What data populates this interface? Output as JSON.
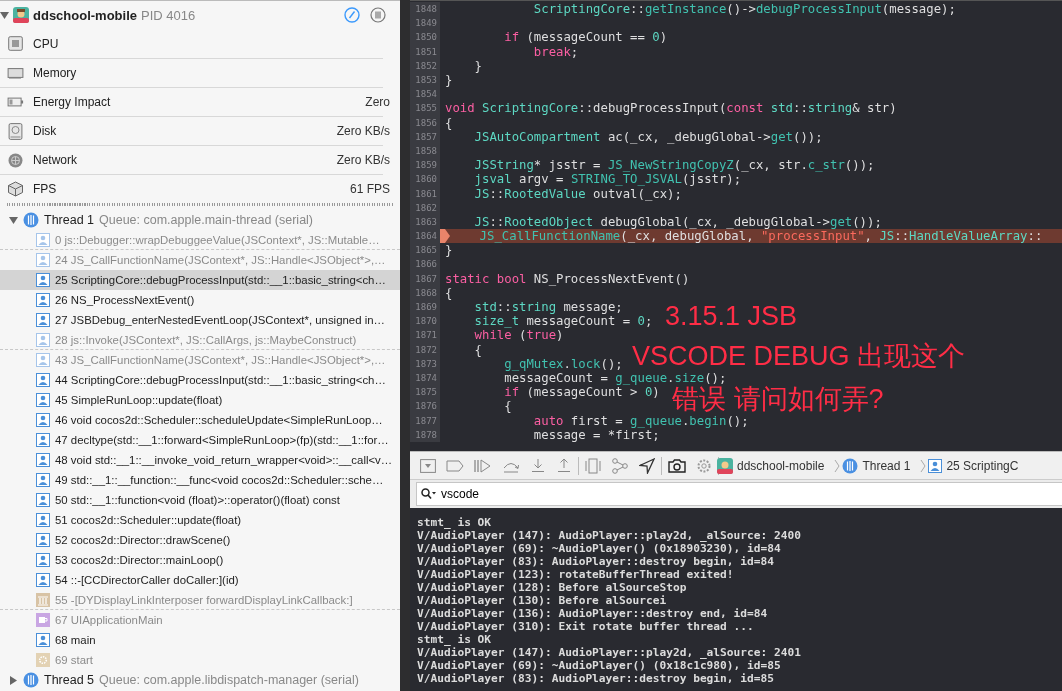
{
  "process": {
    "name": "ddschool-mobile",
    "pid": "PID 4016",
    "expanded": true
  },
  "gauges": [
    {
      "kind": "cpu",
      "label": "CPU"
    },
    {
      "kind": "memory",
      "label": "Memory"
    },
    {
      "kind": "energy",
      "label": "Energy Impact",
      "value": "Zero"
    },
    {
      "kind": "disk",
      "label": "Disk",
      "value": "Zero KB/s"
    },
    {
      "kind": "network",
      "label": "Network",
      "value": "Zero KB/s"
    },
    {
      "kind": "fps",
      "label": "FPS",
      "value": "61 FPS"
    }
  ],
  "threads": [
    {
      "name": "Thread 1",
      "queue": "Queue: com.apple.main-thread (serial)",
      "expanded": true,
      "frames": [
        {
          "kind": "system",
          "label": "0 js::Debugger::wrapDebuggeeValue(JSContext*, JS::Mutable…",
          "dimmed": true,
          "selected": false,
          "separator_after": true
        },
        {
          "kind": "system",
          "label": "24 JS_CallFunctionName(JSContext*, JS::Handle<JSObject*>,…",
          "dimmed": true,
          "selected": false,
          "separator_after": false
        },
        {
          "kind": "user",
          "label": "25 ScriptingCore::debugProcessInput(std::__1::basic_string<ch…",
          "dimmed": false,
          "selected": true,
          "separator_after": false
        },
        {
          "kind": "user",
          "label": "26 NS_ProcessNextEvent()",
          "dimmed": false,
          "selected": false,
          "separator_after": false
        },
        {
          "kind": "user",
          "label": "27 JSBDebug_enterNestedEventLoop(JSContext*, unsigned in…",
          "dimmed": false,
          "selected": false,
          "separator_after": false
        },
        {
          "kind": "system",
          "label": "28 js::Invoke(JSContext*, JS::CallArgs, js::MaybeConstruct)",
          "dimmed": true,
          "selected": false,
          "separator_after": true
        },
        {
          "kind": "system",
          "label": "43 JS_CallFunctionName(JSContext*, JS::Handle<JSObject*>,…",
          "dimmed": true,
          "selected": false,
          "separator_after": false
        },
        {
          "kind": "user",
          "label": "44 ScriptingCore::debugProcessInput(std::__1::basic_string<ch…",
          "dimmed": false,
          "selected": false,
          "separator_after": false
        },
        {
          "kind": "user",
          "label": "45 SimpleRunLoop::update(float)",
          "dimmed": false,
          "selected": false,
          "separator_after": false
        },
        {
          "kind": "user",
          "label": "46 void cocos2d::Scheduler::scheduleUpdate<SimpleRunLoop…",
          "dimmed": false,
          "selected": false,
          "separator_after": false
        },
        {
          "kind": "user",
          "label": "47 decltype(std::__1::forward<SimpleRunLoop>(fp)(std::__1::for…",
          "dimmed": false,
          "selected": false,
          "separator_after": false
        },
        {
          "kind": "user",
          "label": "48 void std::__1::__invoke_void_return_wrapper<void>::__call<v…",
          "dimmed": false,
          "selected": false,
          "separator_after": false
        },
        {
          "kind": "user",
          "label": "49 std::__1::__function::__func<void cocos2d::Scheduler::sche…",
          "dimmed": false,
          "selected": false,
          "separator_after": false
        },
        {
          "kind": "user",
          "label": "50 std::__1::function<void (float)>::operator()(float) const",
          "dimmed": false,
          "selected": false,
          "separator_after": false
        },
        {
          "kind": "user",
          "label": "51 cocos2d::Scheduler::update(float)",
          "dimmed": false,
          "selected": false,
          "separator_after": false
        },
        {
          "kind": "user",
          "label": "52 cocos2d::Director::drawScene()",
          "dimmed": false,
          "selected": false,
          "separator_after": false
        },
        {
          "kind": "user",
          "label": "53 cocos2d::Director::mainLoop()",
          "dimmed": false,
          "selected": false,
          "separator_after": false
        },
        {
          "kind": "user",
          "label": "54 ::-[CCDirectorCaller doCaller:](id)",
          "dimmed": false,
          "selected": false,
          "separator_after": false
        },
        {
          "kind": "library",
          "label": "55 -[DYDisplayLinkInterposer forwardDisplayLinkCallback:]",
          "dimmed": true,
          "selected": false,
          "separator_after": true
        },
        {
          "kind": "uikit",
          "label": "67 UIApplicationMain",
          "dimmed": true,
          "selected": false,
          "separator_after": false
        },
        {
          "kind": "user",
          "label": "68 main",
          "dimmed": false,
          "selected": false,
          "separator_after": false
        },
        {
          "kind": "start",
          "label": "69 start",
          "dimmed": true,
          "selected": false,
          "separator_after": false
        }
      ]
    },
    {
      "name": "Thread 5",
      "queue": "Queue: com.apple.libdispatch-manager (serial)",
      "expanded": false
    }
  ],
  "editor": {
    "lines": [
      {
        "number": "1848",
        "current": false,
        "tokens": [
          {
            "kind": "type",
            "text": "            ScriptingCore"
          },
          {
            "kind": "plain",
            "text": "::"
          },
          {
            "kind": "func",
            "text": "getInstance"
          },
          {
            "kind": "plain",
            "text": "()->"
          },
          {
            "kind": "func",
            "text": "debugProcessInput"
          },
          {
            "kind": "plain",
            "text": "(message);"
          }
        ]
      },
      {
        "number": "1849",
        "current": false
      },
      {
        "number": "1850",
        "current": false,
        "tokens": [
          {
            "kind": "keyword",
            "text": "        if"
          },
          {
            "kind": "plain",
            "text": " (messageCount == "
          },
          {
            "kind": "number",
            "text": "0"
          },
          {
            "kind": "plain",
            "text": ")"
          }
        ]
      },
      {
        "number": "1851",
        "current": false,
        "tokens": [
          {
            "kind": "keyword",
            "text": "            break"
          },
          {
            "kind": "plain",
            "text": ";"
          }
        ]
      },
      {
        "number": "1852",
        "current": false,
        "tokens": [
          {
            "kind": "plain",
            "text": "    }"
          }
        ]
      },
      {
        "number": "1853",
        "current": false,
        "tokens": [
          {
            "kind": "plain",
            "text": "}"
          }
        ]
      },
      {
        "number": "1854",
        "current": false
      },
      {
        "number": "1855",
        "current": false,
        "tokens": [
          {
            "kind": "keyword",
            "text": "void"
          },
          {
            "kind": "type",
            "text": " ScriptingCore"
          },
          {
            "kind": "plain",
            "text": "::debugProcessInput("
          },
          {
            "kind": "keyword",
            "text": "const"
          },
          {
            "kind": "type",
            "text": " std"
          },
          {
            "kind": "plain",
            "text": "::"
          },
          {
            "kind": "type",
            "text": "string"
          },
          {
            "kind": "plain",
            "text": "& str)"
          }
        ]
      },
      {
        "number": "1856",
        "current": false,
        "tokens": [
          {
            "kind": "plain",
            "text": "{"
          }
        ]
      },
      {
        "number": "1857",
        "current": false,
        "tokens": [
          {
            "kind": "type",
            "text": "    JSAutoCompartment"
          },
          {
            "kind": "plain",
            "text": " ac(_cx, _debugGlobal->"
          },
          {
            "kind": "func",
            "text": "get"
          },
          {
            "kind": "plain",
            "text": "());"
          }
        ]
      },
      {
        "number": "1858",
        "current": false
      },
      {
        "number": "1859",
        "current": false,
        "tokens": [
          {
            "kind": "type",
            "text": "    JSString"
          },
          {
            "kind": "plain",
            "text": "* jsstr = "
          },
          {
            "kind": "func",
            "text": "JS_NewStringCopyZ"
          },
          {
            "kind": "plain",
            "text": "(_cx, str."
          },
          {
            "kind": "func",
            "text": "c_str"
          },
          {
            "kind": "plain",
            "text": "());"
          }
        ]
      },
      {
        "number": "1860",
        "current": false,
        "tokens": [
          {
            "kind": "type",
            "text": "    jsval"
          },
          {
            "kind": "plain",
            "text": " argv = "
          },
          {
            "kind": "func",
            "text": "STRING_TO_JSVAL"
          },
          {
            "kind": "plain",
            "text": "(jsstr);"
          }
        ]
      },
      {
        "number": "1861",
        "current": false,
        "tokens": [
          {
            "kind": "type",
            "text": "    JS"
          },
          {
            "kind": "plain",
            "text": "::"
          },
          {
            "kind": "type",
            "text": "RootedValue"
          },
          {
            "kind": "plain",
            "text": " outval(_cx);"
          }
        ]
      },
      {
        "number": "1862",
        "current": false
      },
      {
        "number": "1863",
        "current": false,
        "tokens": [
          {
            "kind": "type",
            "text": "    JS"
          },
          {
            "kind": "plain",
            "text": "::"
          },
          {
            "kind": "type",
            "text": "RootedObject"
          },
          {
            "kind": "plain",
            "text": " debugGlobal(_cx, _debugGlobal->"
          },
          {
            "kind": "func",
            "text": "get"
          },
          {
            "kind": "plain",
            "text": "());"
          }
        ]
      },
      {
        "number": "1864",
        "current": true,
        "tokens": [
          {
            "kind": "func",
            "text": "    JS_CallFunctionName"
          },
          {
            "kind": "plain",
            "text": "(_cx, debugGlobal, "
          },
          {
            "kind": "string",
            "text": "\"processInput\""
          },
          {
            "kind": "plain",
            "text": ", "
          },
          {
            "kind": "type",
            "text": "JS"
          },
          {
            "kind": "plain",
            "text": "::"
          },
          {
            "kind": "type",
            "text": "HandleValueArray"
          },
          {
            "kind": "plain",
            "text": "::"
          }
        ]
      },
      {
        "number": "1865",
        "current": false,
        "tokens": [
          {
            "kind": "plain",
            "text": "}"
          }
        ]
      },
      {
        "number": "1866",
        "current": false
      },
      {
        "number": "1867",
        "current": false,
        "tokens": [
          {
            "kind": "keyword",
            "text": "static"
          },
          {
            "kind": "keyword",
            "text": " bool"
          },
          {
            "kind": "plain",
            "text": " NS_ProcessNextEvent()"
          }
        ]
      },
      {
        "number": "1868",
        "current": false,
        "tokens": [
          {
            "kind": "plain",
            "text": "{"
          }
        ]
      },
      {
        "number": "1869",
        "current": false,
        "tokens": [
          {
            "kind": "type",
            "text": "    std"
          },
          {
            "kind": "plain",
            "text": "::"
          },
          {
            "kind": "type",
            "text": "string"
          },
          {
            "kind": "plain",
            "text": " message;"
          }
        ]
      },
      {
        "number": "1870",
        "current": false,
        "tokens": [
          {
            "kind": "type",
            "text": "    size_t"
          },
          {
            "kind": "plain",
            "text": " messageCount = "
          },
          {
            "kind": "number",
            "text": "0"
          },
          {
            "kind": "plain",
            "text": ";"
          }
        ]
      },
      {
        "number": "1871",
        "current": false,
        "tokens": [
          {
            "kind": "keyword",
            "text": "    while"
          },
          {
            "kind": "plain",
            "text": " ("
          },
          {
            "kind": "keyword",
            "text": "true"
          },
          {
            "kind": "plain",
            "text": ")"
          }
        ]
      },
      {
        "number": "1872",
        "current": false,
        "tokens": [
          {
            "kind": "plain",
            "text": "    {"
          }
        ]
      },
      {
        "number": "1873",
        "current": false,
        "tokens": [
          {
            "kind": "func",
            "text": "        g_qMutex"
          },
          {
            "kind": "plain",
            "text": "."
          },
          {
            "kind": "func",
            "text": "lock"
          },
          {
            "kind": "plain",
            "text": "();"
          }
        ]
      },
      {
        "number": "1874",
        "current": false,
        "tokens": [
          {
            "kind": "plain",
            "text": "        messageCount = "
          },
          {
            "kind": "func",
            "text": "g_queue"
          },
          {
            "kind": "plain",
            "text": "."
          },
          {
            "kind": "func",
            "text": "size"
          },
          {
            "kind": "plain",
            "text": "();"
          }
        ]
      },
      {
        "number": "1875",
        "current": false,
        "tokens": [
          {
            "kind": "keyword",
            "text": "        if"
          },
          {
            "kind": "plain",
            "text": " (messageCount > "
          },
          {
            "kind": "number",
            "text": "0"
          },
          {
            "kind": "plain",
            "text": ")"
          }
        ]
      },
      {
        "number": "1876",
        "current": false,
        "tokens": [
          {
            "kind": "plain",
            "text": "        {"
          }
        ]
      },
      {
        "number": "1877",
        "current": false,
        "tokens": [
          {
            "kind": "keyword",
            "text": "            auto"
          },
          {
            "kind": "plain",
            "text": " first = "
          },
          {
            "kind": "func",
            "text": "g_queue"
          },
          {
            "kind": "plain",
            "text": "."
          },
          {
            "kind": "func",
            "text": "begin"
          },
          {
            "kind": "plain",
            "text": "();"
          }
        ]
      },
      {
        "number": "1878",
        "current": false,
        "tokens": [
          {
            "kind": "plain",
            "text": "            message = *first;"
          }
        ]
      }
    ]
  },
  "annotation": {
    "lines": [
      "3.15.1 JSB",
      "VSCODE DEBUG  出现这个",
      "错误 请问如何弄?"
    ]
  },
  "debug_bar": {
    "breadcrumbs": [
      {
        "kind": "app",
        "label": "ddschool-mobile"
      },
      {
        "kind": "thread",
        "label": "Thread 1"
      },
      {
        "kind": "frame",
        "label": "25 ScriptingC"
      }
    ]
  },
  "console": {
    "filter": {
      "value": "vscode"
    },
    "lines": [
      "stmt_ is OK",
      "V/AudioPlayer (147): AudioPlayer::play2d, _alSource: 2400",
      "V/AudioPlayer (69): ~AudioPlayer() (0x18903230), id=84",
      "V/AudioPlayer (83): AudioPlayer::destroy begin, id=84",
      "V/AudioPlayer (123): rotateBufferThread exited!",
      "V/AudioPlayer (128): Before alSourceStop",
      "V/AudioPlayer (130): Before alSourcei",
      "V/AudioPlayer (136): AudioPlayer::destroy end, id=84",
      "V/AudioPlayer (310): Exit rotate buffer thread ...",
      "stmt_ is OK",
      "V/AudioPlayer (147): AudioPlayer::play2d, _alSource: 2401",
      "V/AudioPlayer (69): ~AudioPlayer() (0x18c1c980), id=85",
      "V/AudioPlayer (83): AudioPlayer::destroy begin, id=85"
    ]
  }
}
